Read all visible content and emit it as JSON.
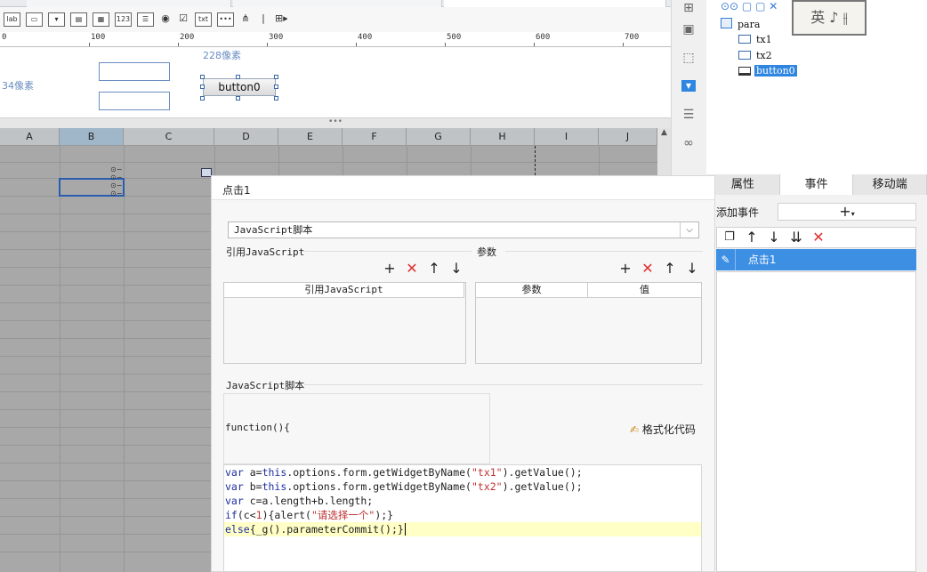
{
  "ruler": {
    "ticks": [
      "0",
      "100",
      "200",
      "300",
      "400",
      "500",
      "600",
      "700"
    ]
  },
  "form": {
    "dim_width": "228像素",
    "dim_height": "34像素",
    "button_label": "button0"
  },
  "sheet": {
    "columns": [
      "A",
      "B",
      "C",
      "D",
      "E",
      "F",
      "G",
      "H",
      "I",
      "J"
    ],
    "selected_column": "B"
  },
  "toolbar": {
    "icons": [
      "label-icon",
      "textbox-icon",
      "combobox-icon",
      "date-icon",
      "calendar-icon",
      "number-icon",
      "list-icon",
      "radio-icon",
      "checkbox-icon",
      "text-icon",
      "password-icon",
      "tree-icon",
      "more-icon"
    ],
    "label_text": "lab",
    "number_text": "123",
    "text_text": "txt"
  },
  "tree": {
    "root": "para",
    "items": [
      "tx1",
      "tx2",
      "button0"
    ],
    "selected": "button0",
    "logo_text": "英"
  },
  "panel_tabs": [
    "属性",
    "事件",
    "移动端"
  ],
  "active_tab": "事件",
  "events": {
    "add_label": "添加事件",
    "add_button": "+",
    "items": [
      "点击1"
    ]
  },
  "dialog": {
    "title": "点击1",
    "type_select": "JavaScript脚本",
    "ref_js_label": "引用JavaScript",
    "params_label": "参数",
    "ref_js_col": "引用JavaScript",
    "params_col1": "参数",
    "params_col2": "值",
    "script_label": "JavaScript脚本",
    "function_header": "function(){",
    "format_button": "格式化代码"
  },
  "code": {
    "lines": [
      "var a=this.options.form.getWidgetByName(\"tx1\").getValue();",
      "var b=this.options.form.getWidgetByName(\"tx2\").getValue();",
      "var c=a.length+b.length;",
      "if(c<1){alert(\"请选择一个\");}",
      "else{_g().parameterCommit();}"
    ]
  },
  "colors": {
    "accent": "#3d8fe4",
    "grid": "#a8a8a8",
    "keyword": "#1e2e9e",
    "string": "#c03030",
    "danger": "#e03030"
  }
}
